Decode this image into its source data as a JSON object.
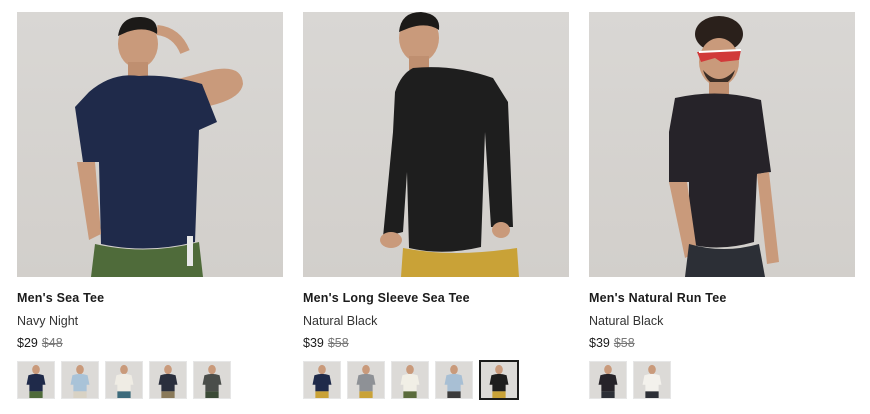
{
  "products": [
    {
      "name": "Men's Sea Tee",
      "color": "Navy Night",
      "price": "$29",
      "compare_price": "$48",
      "shirt_color": "#1f2a4a",
      "pants_color": "#4f6b3a",
      "swatches": [
        {
          "color": "#1f2a4a",
          "pants": "#4f6b3a"
        },
        {
          "color": "#a9c3d8",
          "pants": "#d8d2c4"
        },
        {
          "color": "#efece4",
          "pants": "#3d6b7c"
        },
        {
          "color": "#2a2f3d",
          "pants": "#8a7a5a"
        },
        {
          "color": "#4a4d4a",
          "pants": "#3b4a36"
        }
      ]
    },
    {
      "name": "Men's Long Sleeve Sea Tee",
      "color": "Natural Black",
      "price": "$39",
      "compare_price": "$58",
      "shirt_color": "#1e1e1e",
      "pants_color": "#c9a237",
      "swatches": [
        {
          "color": "#1f2a4a",
          "pants": "#c9a237"
        },
        {
          "color": "#8e9196",
          "pants": "#c9a237"
        },
        {
          "color": "#f1efe6",
          "pants": "#5a6b3c"
        },
        {
          "color": "#a8bfd4",
          "pants": "#3b3b3b"
        },
        {
          "color": "#1e1e1e",
          "pants": "#c9a237"
        }
      ],
      "selected_swatch": 4
    },
    {
      "name": "Men's Natural Run Tee",
      "color": "Natural Black",
      "price": "$39",
      "compare_price": "$58",
      "shirt_color": "#262329",
      "pants_color": "#2c2f36",
      "swatches": [
        {
          "color": "#262329",
          "pants": "#2c2f36"
        },
        {
          "color": "#f3f1ec",
          "pants": "#2c2f36"
        }
      ]
    }
  ]
}
